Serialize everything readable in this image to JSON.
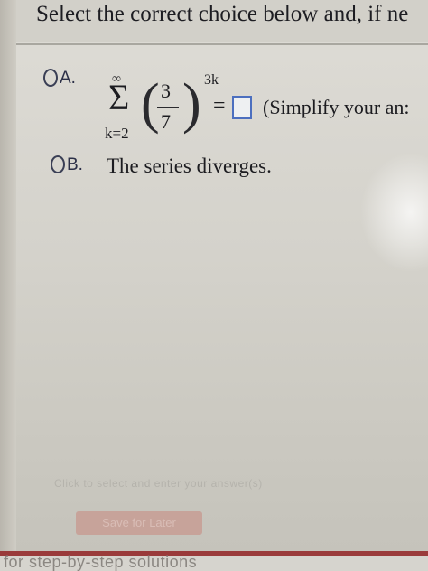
{
  "prompt": {
    "header": "Select the correct choice below and, if ne"
  },
  "option_a": {
    "letter": "A.",
    "sum_upper": "∞",
    "sigma": "Σ",
    "sum_lower": "k=2",
    "paren_left": "(",
    "numerator": "3",
    "denominator": "7",
    "paren_right": ")",
    "exponent": "3k",
    "equals": "=",
    "hint": "(Simplify your an:"
  },
  "option_b": {
    "letter": "B.",
    "text": "The series diverges."
  },
  "footer": {
    "instruction": "Click to select and enter your answer(s)",
    "save_label": "Save for Later",
    "partial_text": "for step-by-step solutions"
  },
  "colors": {
    "answer_box_border": "#4c6fbf",
    "bottom_rule": "#9a3b3b"
  }
}
